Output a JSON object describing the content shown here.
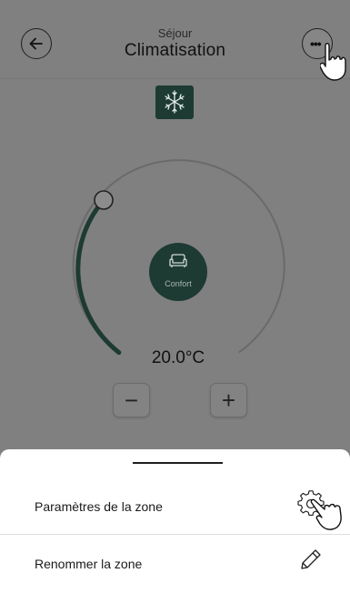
{
  "header": {
    "subtitle": "Séjour",
    "title": "Climatisation",
    "back_icon": "arrow-left-icon",
    "more_icon": "more-dots-icon"
  },
  "mode": {
    "icon": "snowflake-sun-icon"
  },
  "dial": {
    "setpoint": "20.0°C",
    "preset_label": "Confort",
    "preset_icon": "sofa-icon",
    "minus_label": "−",
    "plus_label": "+"
  },
  "sheet": {
    "items": [
      {
        "label": "Paramètres de la zone",
        "icon": "gear-icon"
      },
      {
        "label": "Renommer la zone",
        "icon": "pencil-icon"
      }
    ]
  },
  "colors": {
    "accent": "#1d3a33",
    "overlay": "#808080",
    "sheet_bg": "#ffffff"
  }
}
